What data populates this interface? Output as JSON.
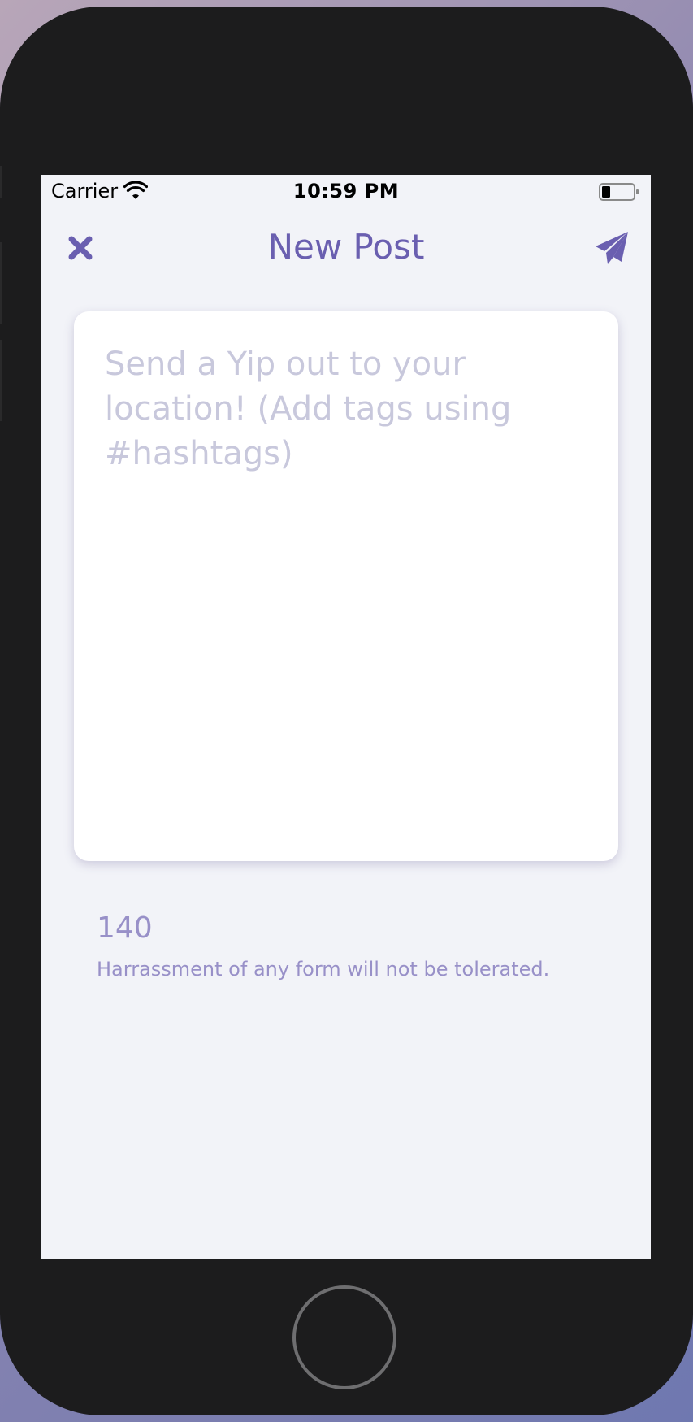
{
  "status_bar": {
    "carrier": "Carrier",
    "time": "10:59 PM",
    "wifi_icon": "wifi-icon",
    "battery_icon": "battery-icon"
  },
  "nav": {
    "title": "New Post",
    "close_icon": "close-icon",
    "send_icon": "paper-plane-icon"
  },
  "composer": {
    "value": "",
    "placeholder": "Send a Yip out to your location! (Add tags using #hashtags)"
  },
  "footer": {
    "char_count": "140",
    "notice": "Harrassment of any form will not be tolerated."
  },
  "colors": {
    "accent": "#6a5fb0",
    "muted_accent": "#9890c8",
    "screen_background": "#f2f3f8",
    "placeholder": "#c8c8dc"
  }
}
